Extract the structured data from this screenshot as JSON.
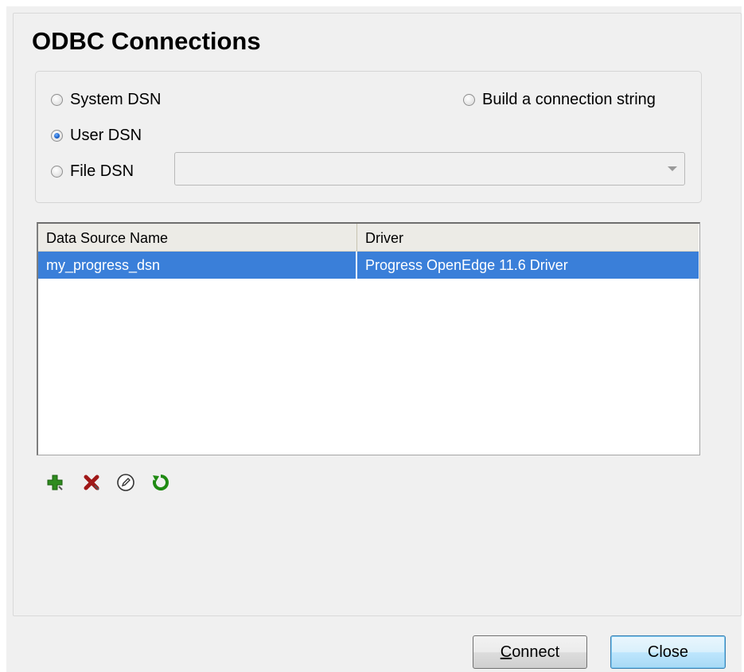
{
  "dialog": {
    "title": "ODBC Connections"
  },
  "dsn_options": {
    "system_dsn": "System DSN",
    "user_dsn": "User DSN",
    "file_dsn": "File DSN",
    "build_connection_string": "Build a connection string",
    "selected": "user_dsn",
    "file_dsn_value": ""
  },
  "table": {
    "columns": [
      "Data Source Name",
      "Driver"
    ],
    "rows": [
      {
        "name": "my_progress_dsn",
        "driver": "Progress OpenEdge 11.6 Driver",
        "selected": true
      }
    ]
  },
  "toolbar": {
    "icons": [
      "add-icon",
      "delete-icon",
      "edit-icon",
      "refresh-icon"
    ]
  },
  "buttons": {
    "connect_mnemonic": "C",
    "connect_rest": "onnect",
    "close": "Close"
  },
  "colors": {
    "selection": "#3a7fd9",
    "add": "#2e8b1e",
    "delete": "#a01818",
    "refresh": "#1f8a12"
  }
}
